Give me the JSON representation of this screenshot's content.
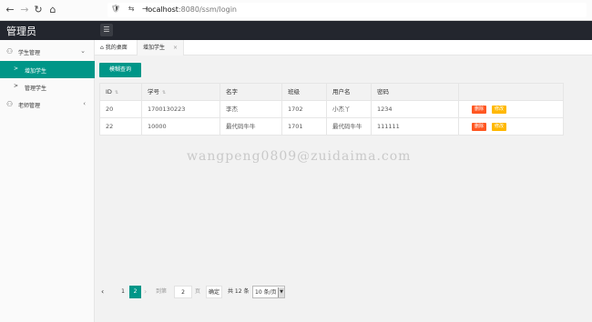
{
  "browser": {
    "url_host": "localhost",
    "url_rest": ":8080/ssm/login",
    "back_icon": "arrow-left-icon",
    "forward_icon": "arrow-right-icon",
    "reload_icon": "reload-icon",
    "home_icon": "home-icon"
  },
  "header": {
    "brand": "管理员",
    "toggle_icon": "menu-icon"
  },
  "sidebar": {
    "groups": [
      {
        "label": "学生管理",
        "icon": "user-icon",
        "expanded": true,
        "items": [
          {
            "label": "增加学生",
            "active": true
          },
          {
            "label": "管理学生",
            "active": false
          }
        ]
      },
      {
        "label": "老师管理",
        "icon": "user-icon",
        "expanded": false
      }
    ]
  },
  "tabs": [
    {
      "label": "我的桌面",
      "icon": "home-icon"
    },
    {
      "label": "增加学生",
      "close": "×"
    }
  ],
  "toolbar": {
    "search_label": "模糊查询"
  },
  "table": {
    "headers": [
      "ID",
      "学号",
      "名字",
      "班级",
      "用户名",
      "密码"
    ],
    "sortable": [
      true,
      true,
      false,
      false,
      false,
      false
    ],
    "rows": [
      {
        "id": "20",
        "student_no": "1700130223",
        "name": "李杰",
        "class": "1702",
        "username": "小杰丫",
        "password": "1234"
      },
      {
        "id": "22",
        "student_no": "10000",
        "name": "最代码牛牛",
        "class": "1701",
        "username": "最代码牛牛",
        "password": "111111"
      }
    ],
    "delete_label": "删除",
    "edit_label": "修改"
  },
  "watermark": "wangpeng0809@zuidaima.com",
  "pager": {
    "prev": "‹",
    "page1": "1",
    "page2": "2",
    "next": "›",
    "goto_label": "到第",
    "goto_value": "2",
    "page_label": "页",
    "confirm_label": "确定",
    "total_label": "共 12 条",
    "page_size": "10 条/页"
  },
  "colors": {
    "accent": "#009688",
    "danger": "#ff5722",
    "warning": "#ffb800",
    "header_bg": "#23262e"
  }
}
